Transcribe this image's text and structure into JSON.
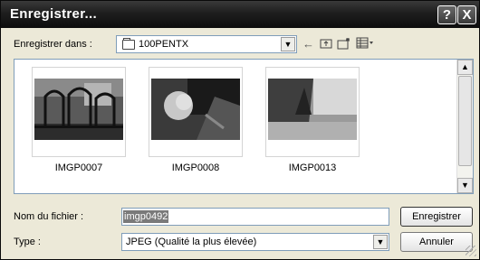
{
  "window": {
    "title": "Enregistrer..."
  },
  "titlebar": {
    "help_label": "?",
    "close_label": "X"
  },
  "lookin": {
    "label": "Enregistrer dans :",
    "value": "100PENTX"
  },
  "toolbar": {
    "back_icon": "arrow-left-icon",
    "up_icon": "up-folder-icon",
    "new_folder_icon": "new-folder-icon",
    "views_icon": "views-menu-icon"
  },
  "files": [
    {
      "name": "IMGP0007"
    },
    {
      "name": "IMGP0008"
    },
    {
      "name": "IMGP0013"
    }
  ],
  "filename": {
    "label": "Nom du fichier :",
    "value": "imgp0492"
  },
  "type": {
    "label": "Type :",
    "value": "JPEG (Qualité la plus élevée)"
  },
  "buttons": {
    "save": "Enregistrer",
    "cancel": "Annuler"
  }
}
